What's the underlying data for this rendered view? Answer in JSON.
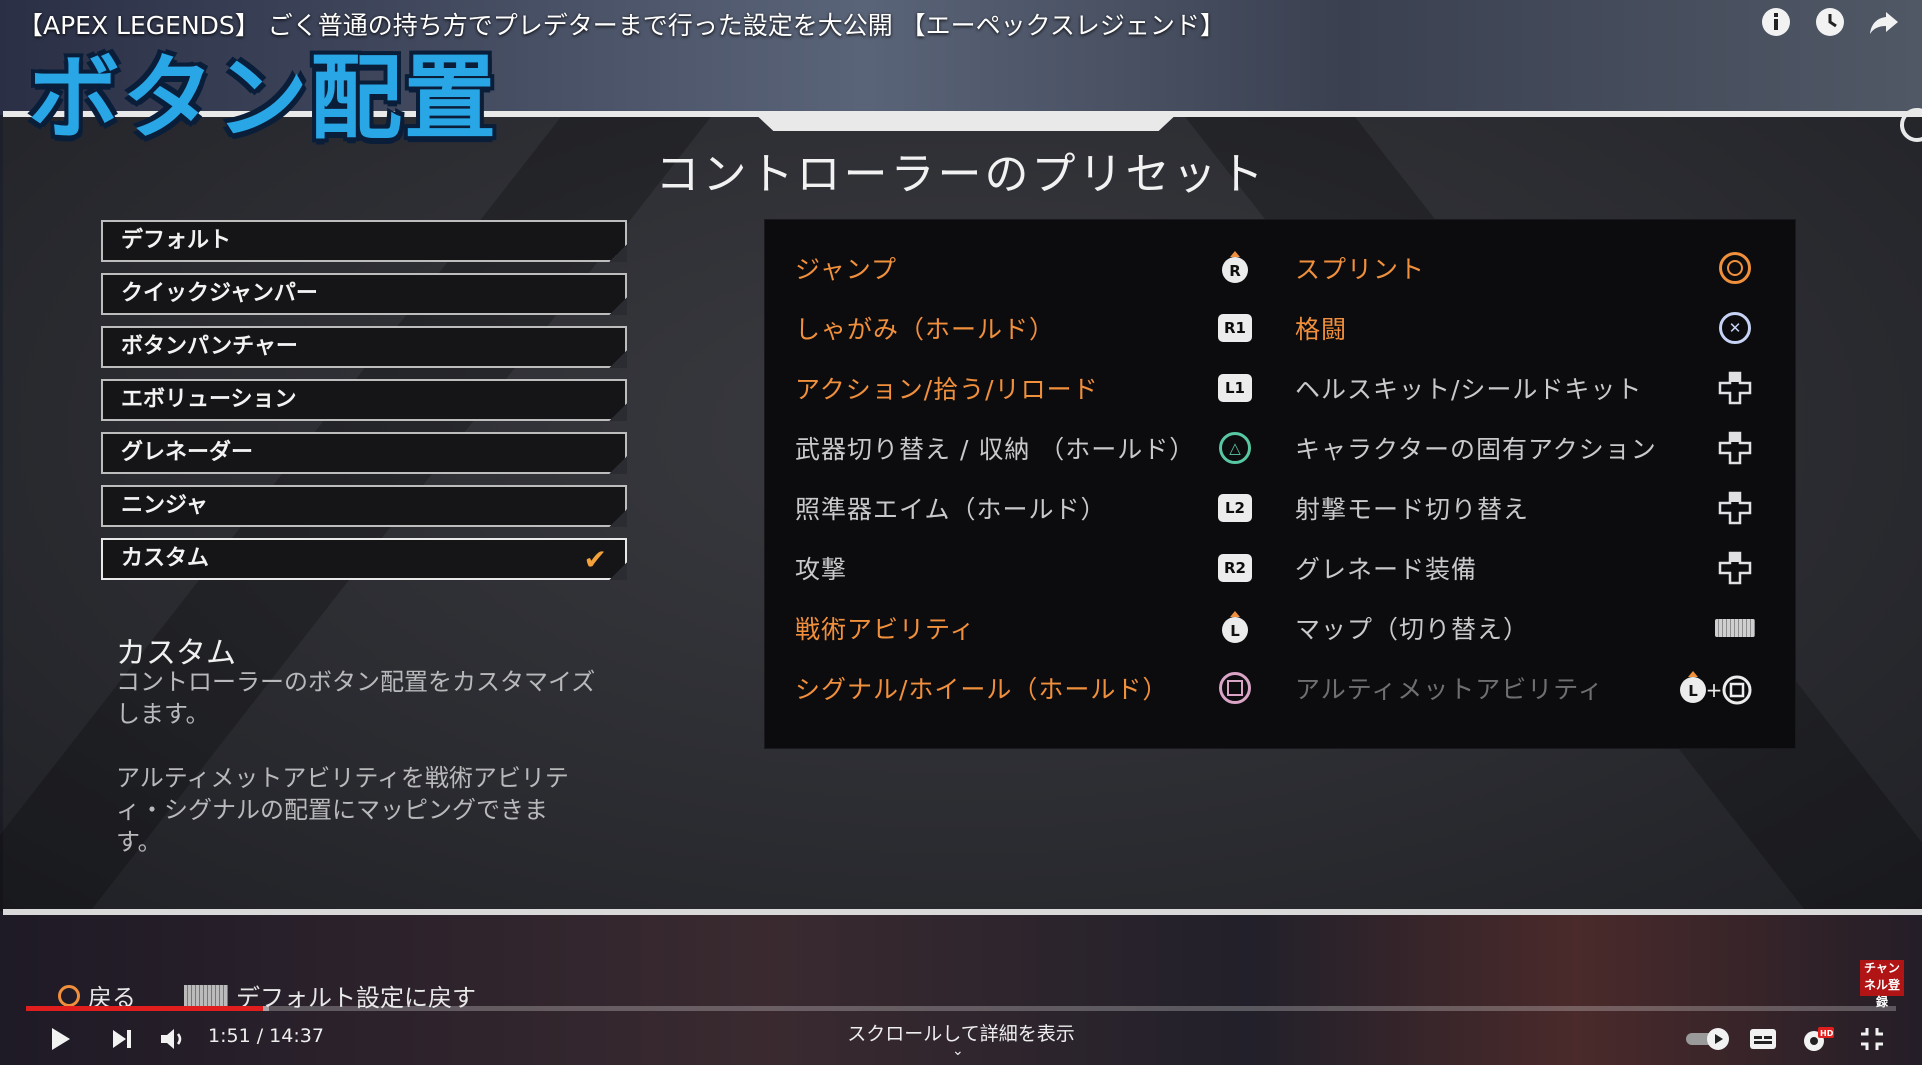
{
  "video": {
    "title": "【APEX LEGENDS】 ごく普通の持ち方でプレデターまで行った設定を大公開 【エーペックスレジェンド】",
    "overlay_caption": "ボタン配置",
    "top_icons": [
      "info-icon",
      "watch-later-icon",
      "share-icon"
    ]
  },
  "game_ui": {
    "title": "コントローラーのプリセット",
    "presets": [
      {
        "label": "デフォルト",
        "selected": false
      },
      {
        "label": "クイックジャンパー",
        "selected": false
      },
      {
        "label": "ボタンパンチャー",
        "selected": false
      },
      {
        "label": "エボリューション",
        "selected": false
      },
      {
        "label": "グレネーダー",
        "selected": false
      },
      {
        "label": "ニンジャ",
        "selected": false
      },
      {
        "label": "カスタム",
        "selected": true
      }
    ],
    "description": {
      "title": "カスタム",
      "text": "コントローラーのボタン配置をカスタマイズします。",
      "text2": "アルティメットアビリティを戦術アビリティ・シグナルの配置にマッピングできます。"
    },
    "mappings_left": [
      {
        "action": "ジャンプ",
        "button": "R",
        "glyph": "stick-r",
        "highlight": true
      },
      {
        "action": "しゃがみ（ホールド）",
        "button": "R1",
        "glyph": "box",
        "highlight": true
      },
      {
        "action": "アクション/拾う/リロード",
        "button": "L1",
        "glyph": "box",
        "highlight": true
      },
      {
        "action": "武器切り替え / 収納 （ホールド）",
        "button": "△",
        "glyph": "triangle",
        "highlight": false
      },
      {
        "action": "照準器エイム（ホールド）",
        "button": "L2",
        "glyph": "box",
        "highlight": false
      },
      {
        "action": "攻撃",
        "button": "R2",
        "glyph": "box",
        "highlight": false
      },
      {
        "action": "戦術アビリティ",
        "button": "L",
        "glyph": "stick-l",
        "highlight": true
      },
      {
        "action": "シグナル/ホイール（ホールド）",
        "button": "□",
        "glyph": "square",
        "highlight": true
      }
    ],
    "mappings_right": [
      {
        "action": "スプリント",
        "button": "○",
        "glyph": "circle",
        "highlight": true
      },
      {
        "action": "格闘",
        "button": "×",
        "glyph": "cross",
        "highlight": true
      },
      {
        "action": "ヘルスキット/シールドキット",
        "button": "dpad",
        "glyph": "dpad",
        "highlight": false
      },
      {
        "action": "キャラクターの固有アクション",
        "button": "dpad",
        "glyph": "dpad",
        "highlight": false
      },
      {
        "action": "射撃モード切り替え",
        "button": "dpad",
        "glyph": "dpad",
        "highlight": false
      },
      {
        "action": "グレネード装備",
        "button": "dpad",
        "glyph": "dpad",
        "highlight": false
      },
      {
        "action": "マップ（切り替え）",
        "button": "touchpad",
        "glyph": "touchpad",
        "highlight": false
      },
      {
        "action": "アルティメットアビリティ",
        "button": "L+□",
        "glyph": "combo",
        "highlight": false,
        "dim": true
      }
    ],
    "footer": {
      "back": "戻る",
      "reset": "デフォルト設定に戻す"
    }
  },
  "channel_badge": "チャンネル登録",
  "player": {
    "current_time": "1:51",
    "total_time": "14:37",
    "time_display": "1:51 / 14:37",
    "progress_fraction": 0.127,
    "buffer_fraction": 0.13,
    "scroll_hint": "スクロールして詳細を表示",
    "hd_badge": "HD",
    "colors": {
      "accent": "#f08f3c",
      "progress": "#e01e1e",
      "overlay_text": "#28a6e6"
    }
  }
}
